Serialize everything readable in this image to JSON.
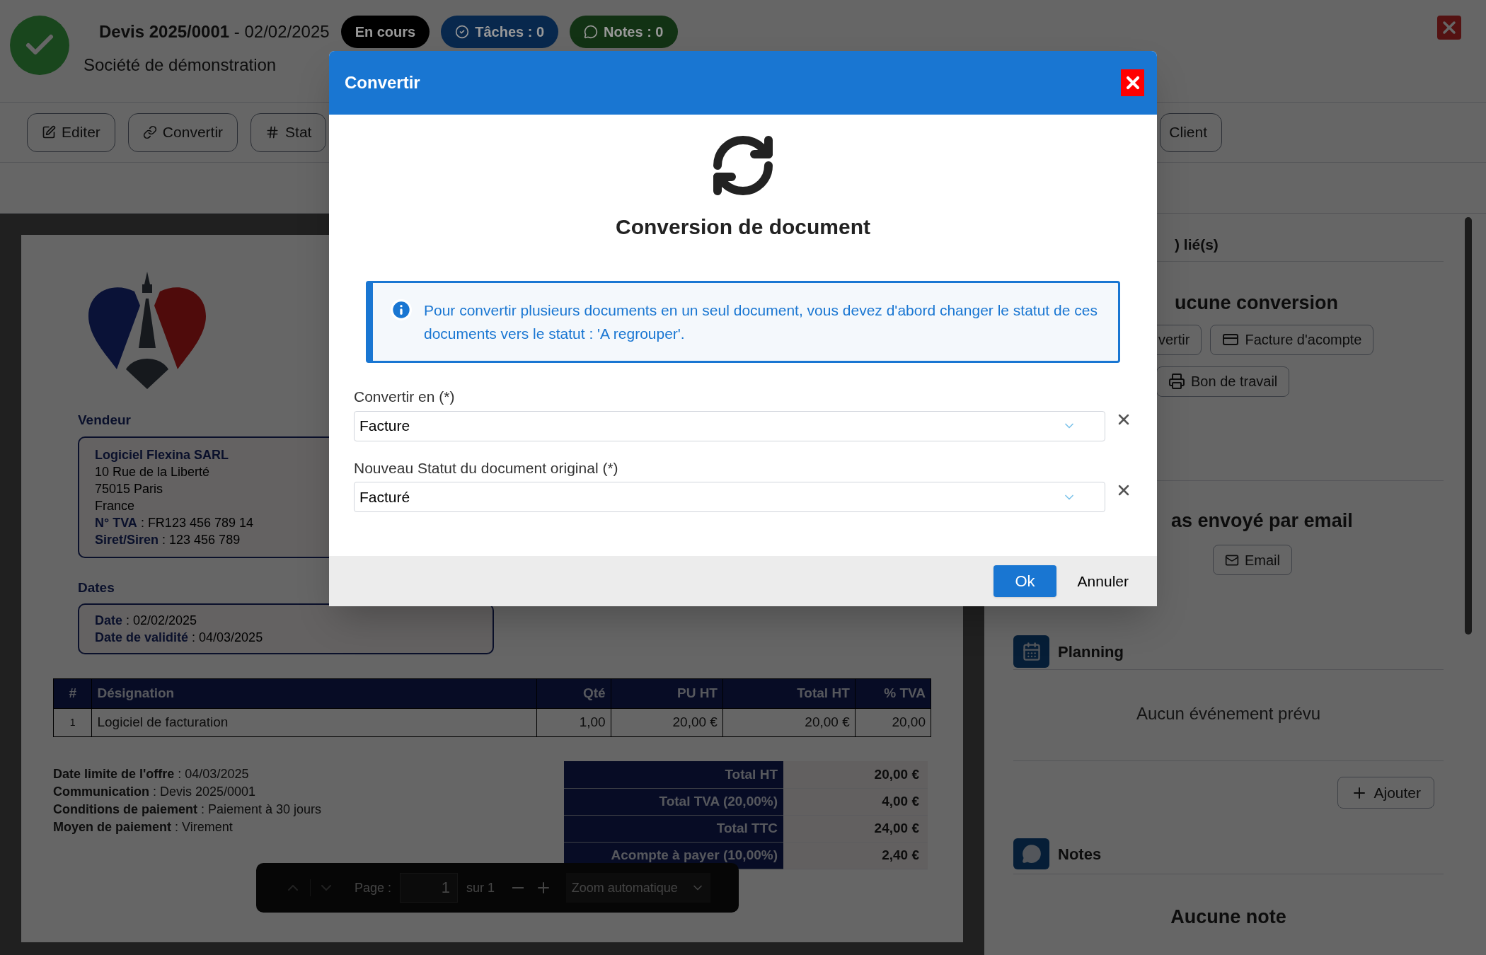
{
  "header": {
    "title": "**Devis 2025/0001** - 02/02/2025",
    "company": "Société de démonstration",
    "badges": [
      {
        "kind": "plain",
        "label": "En cours",
        "color": "#000000"
      },
      {
        "kind": "check",
        "label": "Tâches : 0",
        "color": "#08284d"
      },
      {
        "kind": "chat",
        "label": "Notes : 0",
        "color": "#123214"
      }
    ]
  },
  "toolbar": {
    "buttons": [
      {
        "kind": "edit",
        "label": "Editer"
      },
      {
        "kind": "link",
        "label": "Convertir"
      },
      {
        "kind": "hash",
        "label": "Stat"
      }
    ],
    "right_button": {
      "label": "Client"
    }
  },
  "document": {
    "vendor_title": "Vendeur",
    "vendor_name": "Logiciel Flexina SARL",
    "vendor_lines": [
      "10 Rue de la Liberté",
      "75015 Paris",
      "France",
      "**N° TVA** : FR123 456 789 14",
      "**Siret/Siren** : 123 456 789"
    ],
    "dates_title": "Dates",
    "dates_lines": [
      "**Date** : 02/02/2025",
      "**Date de validité** : 04/03/2025"
    ],
    "table": {
      "columns": [
        "#",
        "Désignation",
        "Qté",
        "PU HT",
        "Total HT",
        "% TVA"
      ],
      "rows": [
        [
          "1",
          "Logiciel de facturation",
          "1,00",
          "20,00 €",
          "20,00 €",
          "20,00"
        ]
      ]
    },
    "info_lines": [
      "**Date limite de l'offre** : 04/03/2025",
      "**Communication** : Devis 2025/0001",
      "**Conditions de paiement** : Paiement à 30 jours",
      "**Moyen de paiement** : Virement"
    ],
    "totals": [
      {
        "label": "Total HT",
        "value": "20,00 €"
      },
      {
        "label": "Total TVA (20,00%)",
        "value": "4,00 €"
      },
      {
        "label": "Total TTC",
        "value": "24,00 €"
      },
      {
        "label": "Acompte à payer (10,00%)",
        "value": "2,40 €"
      }
    ]
  },
  "pdf_toolbar": {
    "page_label": "Page :",
    "page": "1",
    "page_count": "sur 1",
    "zoom": "Zoom automatique"
  },
  "side_panel": {
    "linked_title": ") lié(s)",
    "conversion_title": "ucune conversion",
    "conversion_buttons": [
      {
        "kind": "plain",
        "label": "vertir"
      },
      {
        "kind": "card",
        "label": "Facture d'acompte"
      },
      {
        "kind": "print",
        "label": "Bon de travail"
      }
    ],
    "email_title": "as envoyé par email",
    "email_button": "Email",
    "planning_title": "Planning",
    "planning_empty": "Aucun événement prévu",
    "add_button": "Ajouter",
    "notes_title": "Notes",
    "notes_empty": "Aucune note"
  },
  "dialog": {
    "title": "Convertir",
    "heading": "Conversion de document",
    "info": "Pour convertir plusieurs documents en un seul document, vous devez d'abord changer le statut de ces documents vers le statut : 'A regrouper'.",
    "fields": [
      {
        "label": "Convertir en (*)",
        "value": "Facture"
      },
      {
        "label": "Nouveau Statut du document original (*)",
        "value": "Facturé"
      }
    ],
    "ok": "Ok",
    "cancel": "Annuler"
  }
}
